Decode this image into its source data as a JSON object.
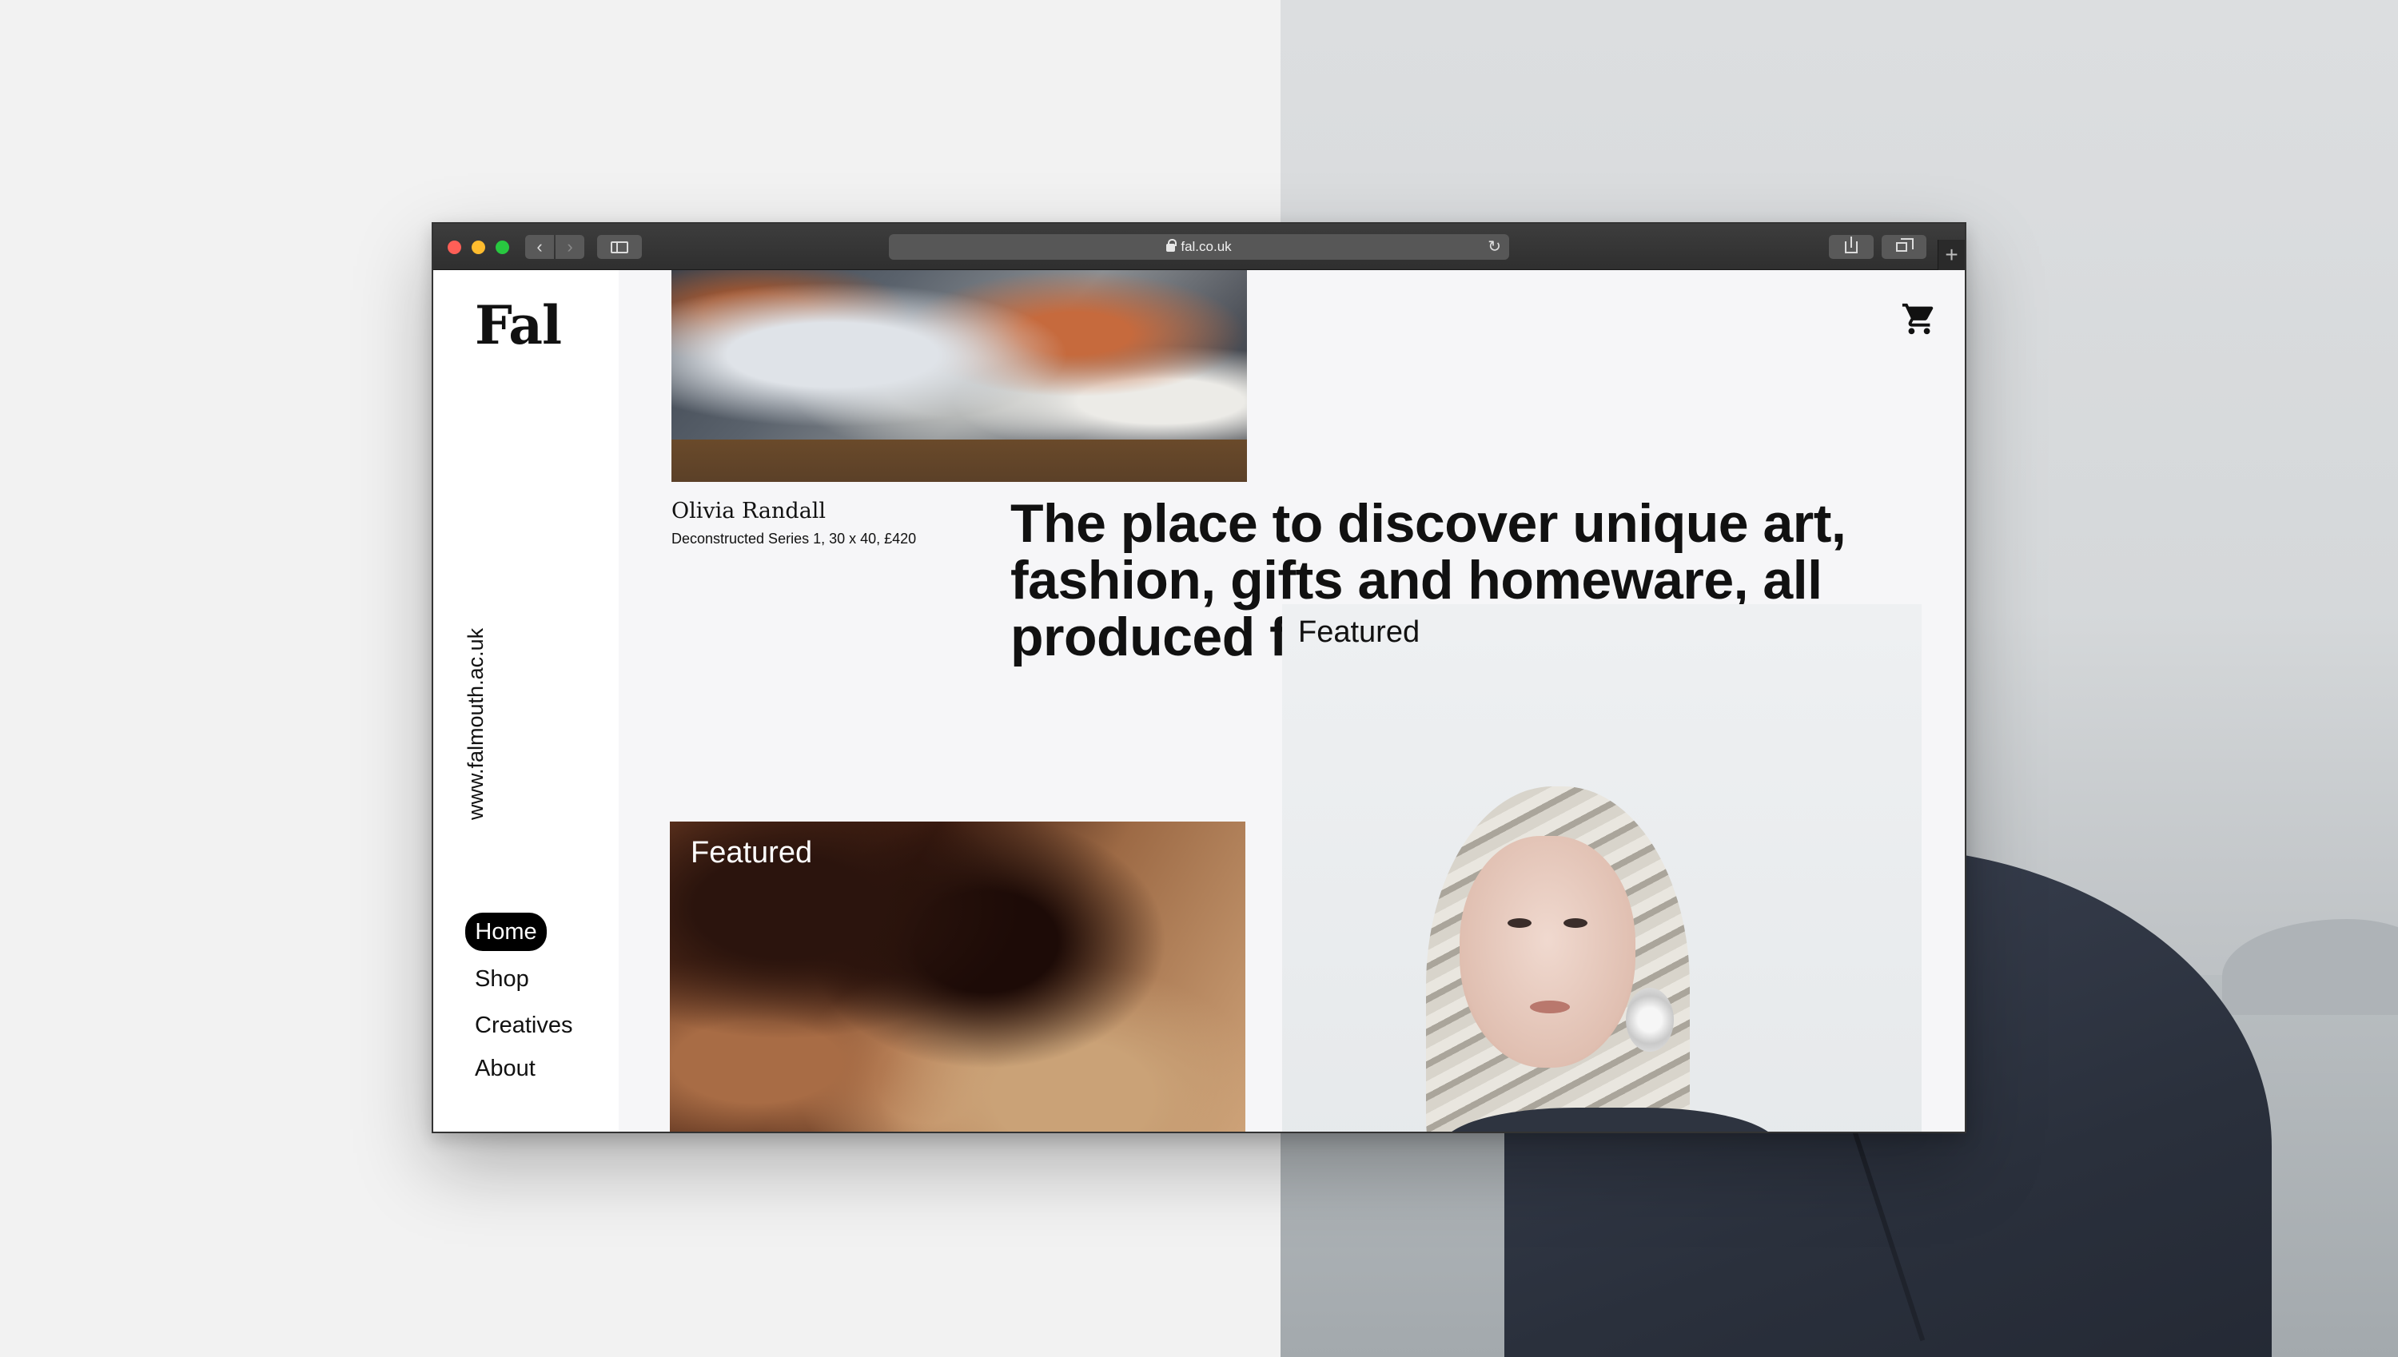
{
  "browser": {
    "url": "fal.co.uk"
  },
  "site": {
    "logo": "Fal",
    "vertical_url": "www.falmouth.ac.uk"
  },
  "nav": {
    "items": [
      {
        "label": "Home"
      },
      {
        "label": "Shop"
      },
      {
        "label": "Creatives"
      },
      {
        "label": "About"
      }
    ],
    "active": "Home"
  },
  "hero_artwork": {
    "artist": "Olivia Randall",
    "caption": "Deconstructed Series 1, 30 x 40, £420"
  },
  "headline": "The place to discover unique art, fashion, gifts and homeware, all produced from Falm",
  "featured_cards": [
    {
      "label": "Featured"
    },
    {
      "label": "Featured"
    }
  ],
  "colors": {
    "nav_active_bg": "#000000",
    "page_bg": "#f6f6f8",
    "sidebar_bg": "#ffffff"
  },
  "icons": {
    "cart": "cart-icon",
    "lock": "lock-icon",
    "reload": "reload-icon"
  }
}
